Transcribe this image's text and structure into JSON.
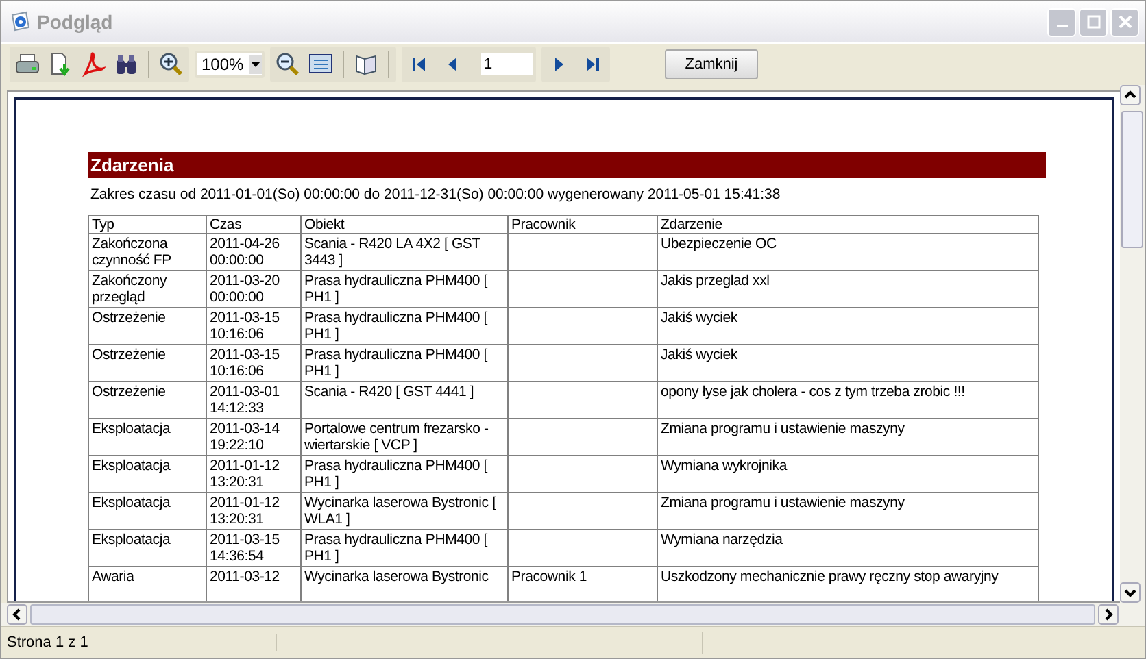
{
  "window": {
    "title": "Podgląd"
  },
  "toolbar": {
    "zoom": "100%",
    "page": "1",
    "close_button": "Zamknij"
  },
  "report": {
    "title": "Zdarzenia",
    "subtitle": "Zakres czasu od 2011-01-01(So) 00:00:00 do 2011-12-31(So) 00:00:00  wygenerowany 2011-05-01 15:41:38",
    "columns": [
      "Typ",
      "Czas",
      "Obiekt",
      "Pracownik",
      "Zdarzenie"
    ],
    "rows": [
      {
        "typ": "Zakończona czynność FP",
        "czas": "2011-04-26 00:00:00",
        "obiekt": "Scania - R420 LA 4X2 [ GST 3443 ]",
        "pracownik": "",
        "zdarzenie": "Ubezpieczenie OC"
      },
      {
        "typ": "Zakończony przegląd",
        "czas": "2011-03-20 00:00:00",
        "obiekt": "Prasa hydrauliczna PHM400 [ PH1 ]",
        "pracownik": "",
        "zdarzenie": "Jakis przeglad xxl"
      },
      {
        "typ": "Ostrzeżenie",
        "czas": "2011-03-15 10:16:06",
        "obiekt": "Prasa hydrauliczna PHM400 [ PH1 ]",
        "pracownik": "",
        "zdarzenie": "Jakiś wyciek"
      },
      {
        "typ": "Ostrzeżenie",
        "czas": "2011-03-15 10:16:06",
        "obiekt": "Prasa hydrauliczna PHM400 [ PH1 ]",
        "pracownik": "",
        "zdarzenie": "Jakiś wyciek"
      },
      {
        "typ": "Ostrzeżenie",
        "czas": "2011-03-01 14:12:33",
        "obiekt": "Scania - R420 [ GST 4441 ]",
        "pracownik": "",
        "zdarzenie": "opony łyse jak cholera - cos z tym trzeba zrobic !!!"
      },
      {
        "typ": "Eksploatacja",
        "czas": "2011-03-14 19:22:10",
        "obiekt": "Portalowe centrum frezarsko - wiertarskie [ VCP ]",
        "pracownik": "",
        "zdarzenie": "Zmiana programu i ustawienie maszyny"
      },
      {
        "typ": "Eksploatacja",
        "czas": "2011-01-12 13:20:31",
        "obiekt": "Prasa hydrauliczna PHM400 [ PH1 ]",
        "pracownik": "",
        "zdarzenie": "Wymiana wykrojnika"
      },
      {
        "typ": "Eksploatacja",
        "czas": "2011-01-12 13:20:31",
        "obiekt": "Wycinarka laserowa Bystronic [ WLA1 ]",
        "pracownik": "",
        "zdarzenie": "Zmiana programu i ustawienie maszyny"
      },
      {
        "typ": "Eksploatacja",
        "czas": "2011-03-15 14:36:54",
        "obiekt": "Prasa hydrauliczna PHM400 [ PH1 ]",
        "pracownik": "",
        "zdarzenie": "Wymiana narzędzia"
      },
      {
        "typ": "Awaria",
        "czas": "2011-03-12",
        "obiekt": "Wycinarka laserowa Bystronic",
        "pracownik": "Pracownik 1",
        "zdarzenie": "Uszkodzony mechanicznie prawy ręczny stop awaryjny"
      }
    ]
  },
  "status_bar": {
    "page_info": "Strona 1 z 1"
  }
}
